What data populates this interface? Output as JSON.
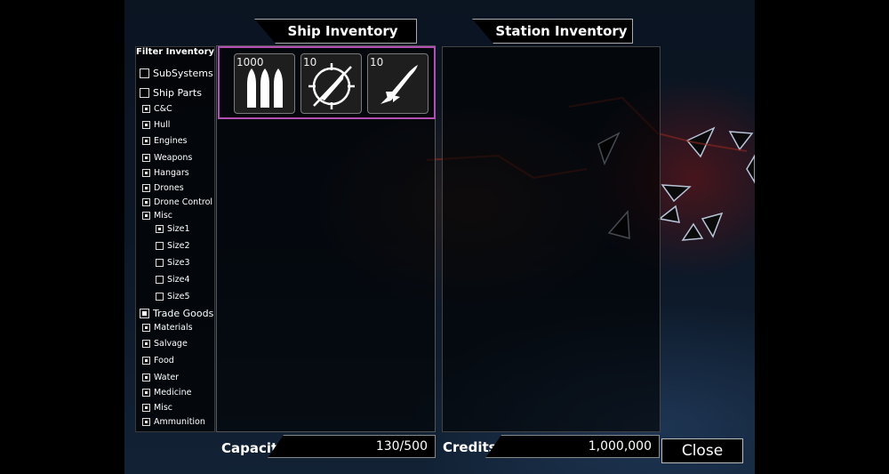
{
  "filter": {
    "title": "Filter Inventory",
    "items": [
      {
        "label": "SubSystems",
        "checked": false
      },
      {
        "label": "Ship Parts",
        "checked": false
      },
      {
        "label": "C&C",
        "checked": true
      },
      {
        "label": "Hull",
        "checked": true
      },
      {
        "label": "Engines",
        "checked": true
      },
      {
        "label": "Weapons",
        "checked": true
      },
      {
        "label": "Hangars",
        "checked": true
      },
      {
        "label": "Drones",
        "checked": true
      },
      {
        "label": "Drone Control",
        "checked": true
      },
      {
        "label": "Misc",
        "checked": true
      },
      {
        "label": "Size1",
        "checked": true
      },
      {
        "label": "Size2",
        "checked": false
      },
      {
        "label": "Size3",
        "checked": false
      },
      {
        "label": "Size4",
        "checked": false
      },
      {
        "label": "Size5",
        "checked": false
      },
      {
        "label": "Trade Goods",
        "checked": true
      },
      {
        "label": "Materials",
        "checked": true
      },
      {
        "label": "Salvage",
        "checked": true
      },
      {
        "label": "Food",
        "checked": true
      },
      {
        "label": "Water",
        "checked": true
      },
      {
        "label": "Medicine",
        "checked": true
      },
      {
        "label": "Misc",
        "checked": true
      },
      {
        "label": "Ammunition",
        "checked": true
      }
    ]
  },
  "ship_inventory": {
    "title": "Ship Inventory",
    "slots": [
      {
        "qty": "1000",
        "icon": "ammunition-icon"
      },
      {
        "qty": "10",
        "icon": "guided-missile-icon"
      },
      {
        "qty": "10",
        "icon": "missile-icon"
      }
    ]
  },
  "station_inventory": {
    "title": "Station Inventory"
  },
  "capacity": {
    "label": "Capacity",
    "value": "130/500"
  },
  "credits": {
    "label": "Credits",
    "value": "1,000,000"
  },
  "close_label": "Close",
  "colors": {
    "selection": "#b34fb3",
    "panel_border": "#555555"
  }
}
